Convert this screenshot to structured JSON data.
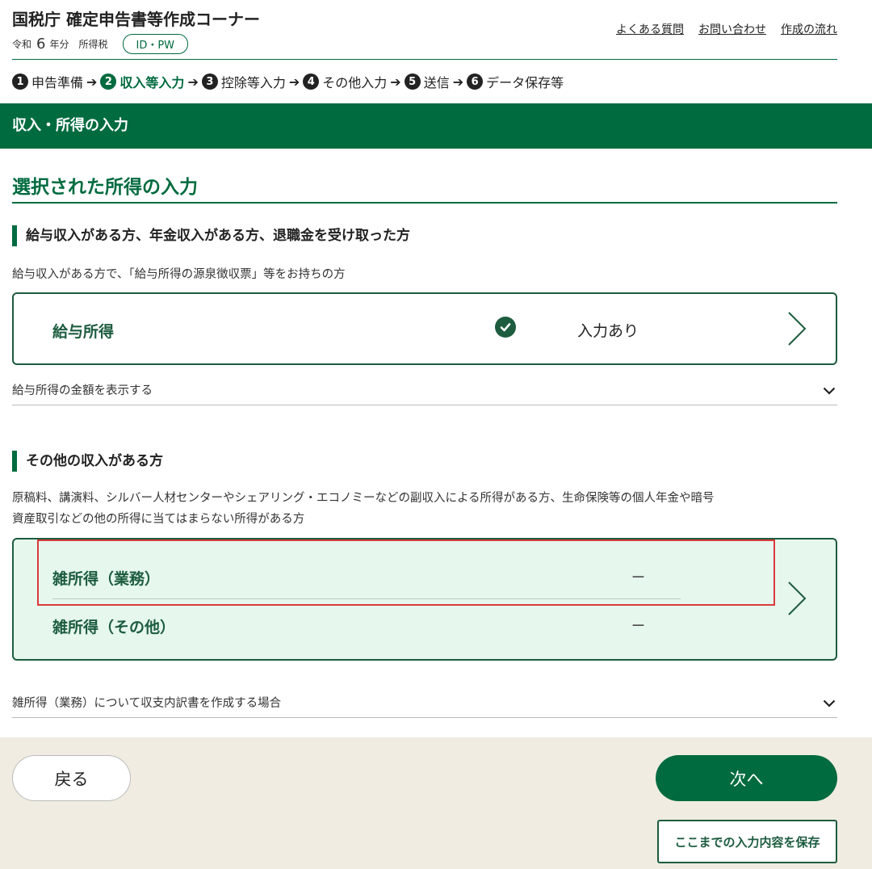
{
  "header": {
    "title": "国税庁 確定申告書等作成コーナー",
    "era": "令和",
    "year": "6",
    "year_suffix": "年分",
    "tax_type": "所得税",
    "badge": "ID・PW",
    "links": [
      "よくある質問",
      "お問い合わせ",
      "作成の流れ"
    ]
  },
  "steps": [
    {
      "num": "1",
      "label": "申告準備",
      "active": false
    },
    {
      "num": "2",
      "label": "収入等入力",
      "active": true
    },
    {
      "num": "3",
      "label": "控除等入力",
      "active": false
    },
    {
      "num": "4",
      "label": "その他入力",
      "active": false
    },
    {
      "num": "5",
      "label": "送信",
      "active": false
    },
    {
      "num": "6",
      "label": "データ保存等",
      "active": false
    }
  ],
  "section_title": "収入・所得の入力",
  "page_heading": "選択された所得の入力",
  "salary_section": {
    "heading": "給与収入がある方、年金収入がある方、退職金を受け取った方",
    "description": "給与収入がある方で、「給与所得の源泉徴収票」等をお持ちの方",
    "card_label": "給与所得",
    "status": "入力あり",
    "toggle": "給与所得の金額を表示する"
  },
  "other_section": {
    "heading": "その他の収入がある方",
    "description_line1": "原稿料、講演料、シルバー人材センターやシェアリング・エコノミーなどの副収入による所得がある方、生命保険等の個人年金や暗号",
    "description_line2": "資産取引などの他の所得に当てはまらない所得がある方",
    "item1_label": "雑所得（業務）",
    "item1_value": "－",
    "item2_label": "雑所得（その他）",
    "item2_value": "－",
    "toggle": "雑所得（業務）について収支内訳書を作成する場合"
  },
  "footer": {
    "back": "戻る",
    "next": "次へ",
    "save": "ここまでの入力内容を保存"
  },
  "colors": {
    "brand_green": "#006b3f",
    "card_green": "#1d5c3f",
    "card_bg": "#e6f7ee",
    "footer_bg": "#f0ece1",
    "highlight": "#d93a3a"
  }
}
